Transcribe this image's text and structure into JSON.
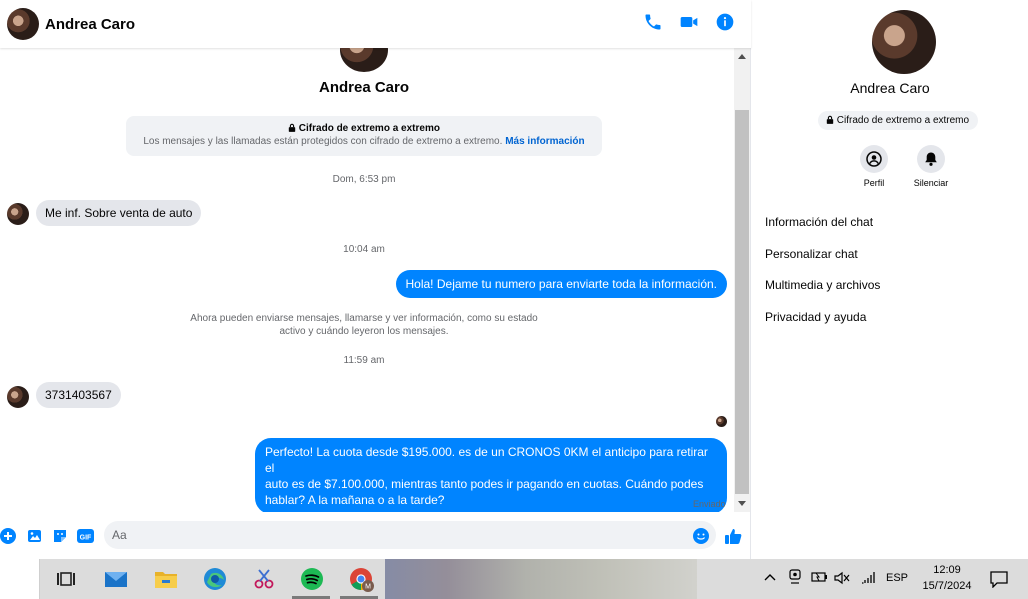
{
  "header": {
    "contact_name": "Andrea Caro",
    "icons": [
      "phone-icon",
      "video-icon",
      "info-icon"
    ],
    "accent": "#0084ff"
  },
  "conversation": {
    "contact_name": "Andrea Caro",
    "e2e_title": "Cifrado de extremo a extremo",
    "e2e_text": "Los mensajes y las llamadas están protegidos con cifrado de extremo a extremo.",
    "e2e_link": "Más información",
    "timestamps": [
      "Dom, 6:53 pm",
      "10:04 am",
      "11:59 am"
    ],
    "system_note_line1": "Ahora pueden enviarse mensajes, llamarse y ver información, como su estado",
    "system_note_line2": "activo y cuándo leyeron los mensajes.",
    "messages": [
      {
        "from": "contact",
        "text": "Me inf. Sobre venta de auto"
      },
      {
        "from": "me",
        "text": "Hola! Dejame tu numero  para enviarte toda la información."
      },
      {
        "from": "contact",
        "text": "3731403567"
      },
      {
        "from": "me",
        "text_lines": [
          "Perfecto! La cuota desde $195.000. es de un CRONOS 0KM el anticipo para retirar el",
          "auto es de $7.100.000, mientras tanto podes ir pagando en cuotas. Cuándo podes",
          "hablar? A la mañana o a la tarde?"
        ]
      }
    ],
    "status": "Enviado"
  },
  "composer": {
    "placeholder": "Aa",
    "icons": [
      "plus-icon",
      "image-icon",
      "sticker-icon",
      "gif-icon",
      "emoji-icon",
      "like-icon"
    ],
    "gif_label": "GIF"
  },
  "sidebar": {
    "name": "Andrea Caro",
    "e2e_badge": "Cifrado de extremo a extremo",
    "actions": [
      {
        "label": "Perfil",
        "icon": "profile-icon"
      },
      {
        "label": "Silenciar",
        "icon": "bell-icon"
      }
    ],
    "items": [
      {
        "label": "Información del chat"
      },
      {
        "label": "Personalizar chat"
      },
      {
        "label": "Multimedia y archivos"
      },
      {
        "label": "Privacidad y ayuda"
      }
    ]
  },
  "taskbar": {
    "apps": [
      "task-view-icon",
      "mail-icon",
      "file-explorer-icon",
      "edge-icon",
      "snipping-tool-icon",
      "spotify-icon",
      "chrome-icon"
    ],
    "language": "ESP",
    "time": "12:09",
    "date": "15/7/2024"
  }
}
